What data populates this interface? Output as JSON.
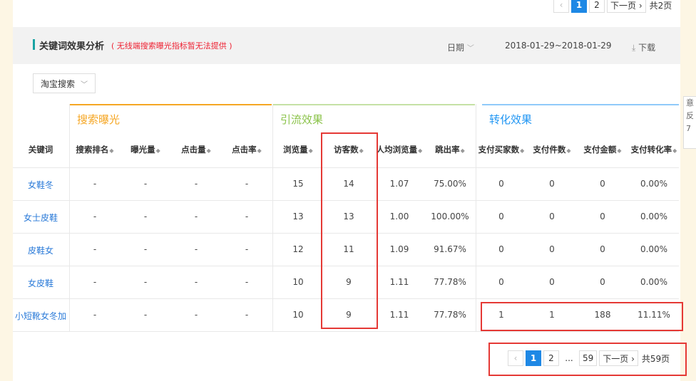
{
  "top_pager": {
    "prev": "‹",
    "pages": [
      "1",
      "2"
    ],
    "active": "1",
    "next": "下一页 ›",
    "total": "共2页"
  },
  "header": {
    "title": "关键词效果分析",
    "note": "( 无线端搜索曝光指标暂无法提供 )",
    "date_label": "日期",
    "date_range": "2018-01-29~2018-01-29",
    "download": "下载"
  },
  "source_select": {
    "value": "淘宝搜索"
  },
  "right_strip": [
    "意",
    "反",
    "7"
  ],
  "groups": [
    {
      "label": "搜索曝光",
      "color": "#f5a623"
    },
    {
      "label": "引流效果",
      "color": "#8bc34a"
    },
    {
      "label": "转化效果",
      "color": "#2196f3"
    }
  ],
  "columns": [
    "关键词",
    "搜索排名",
    "曝光量",
    "点击量",
    "点击率",
    "浏览量",
    "访客数",
    "人均浏览量",
    "跳出率",
    "支付买家数",
    "支付件数",
    "支付金额",
    "支付转化率"
  ],
  "rows": [
    [
      "女鞋冬",
      "-",
      "-",
      "-",
      "-",
      "15",
      "14",
      "1.07",
      "75.00%",
      "0",
      "0",
      "0",
      "0.00%"
    ],
    [
      "女士皮鞋",
      "-",
      "-",
      "-",
      "-",
      "13",
      "13",
      "1.00",
      "100.00%",
      "0",
      "0",
      "0",
      "0.00%"
    ],
    [
      "皮鞋女",
      "-",
      "-",
      "-",
      "-",
      "12",
      "11",
      "1.09",
      "91.67%",
      "0",
      "0",
      "0",
      "0.00%"
    ],
    [
      "女皮鞋",
      "-",
      "-",
      "-",
      "-",
      "10",
      "9",
      "1.11",
      "77.78%",
      "0",
      "0",
      "0",
      "0.00%"
    ],
    [
      "小短靴女冬加",
      "-",
      "-",
      "-",
      "-",
      "10",
      "9",
      "1.11",
      "77.78%",
      "1",
      "1",
      "188",
      "11.11%"
    ]
  ],
  "bottom_pager": {
    "prev": "‹",
    "pages": [
      "1",
      "2"
    ],
    "ellipsis": "...",
    "last": "59",
    "active": "1",
    "next": "下一页 ›",
    "total": "共59页"
  }
}
